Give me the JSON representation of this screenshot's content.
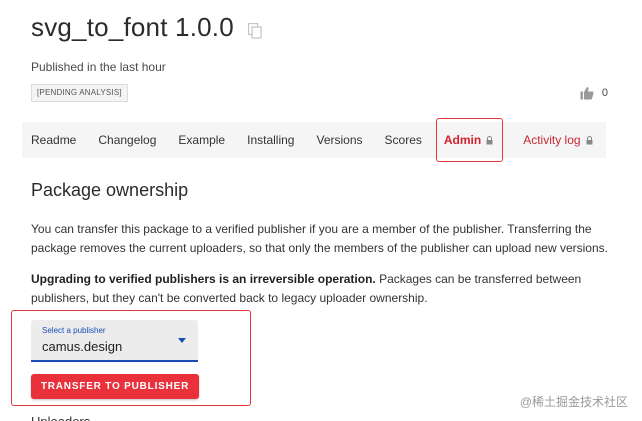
{
  "package": {
    "title": "svg_to_font 1.0.0",
    "published": "Published in the last hour",
    "badge": "[PENDING ANALYSIS]",
    "likes": "0"
  },
  "tabs": [
    {
      "label": "Readme"
    },
    {
      "label": "Changelog"
    },
    {
      "label": "Example"
    },
    {
      "label": "Installing"
    },
    {
      "label": "Versions"
    },
    {
      "label": "Scores"
    },
    {
      "label": "Admin"
    },
    {
      "label": "Activity log"
    }
  ],
  "section": {
    "title": "Package ownership",
    "para1": "You can transfer this package to a verified publisher if you are a member of the publisher. Transferring the package removes the current uploaders, so that only the members of the publisher can upload new versions.",
    "para2_bold": "Upgrading to verified publishers is an irreversible operation.",
    "para2_rest": " Packages can be transferred between publishers, but they can't be converted back to legacy uploader ownership."
  },
  "publisher_select": {
    "label": "Select a publisher",
    "value": "camus.design"
  },
  "transfer_button": "TRANSFER TO PUBLISHER",
  "next_heading": "Uploaders",
  "watermark": "@稀土掘金技术社区",
  "colors": {
    "accent_red": "#e8313b",
    "admin_tab": "#d4212e",
    "select_blue": "#1a4fb5",
    "annotation_red": "#e4393c"
  }
}
